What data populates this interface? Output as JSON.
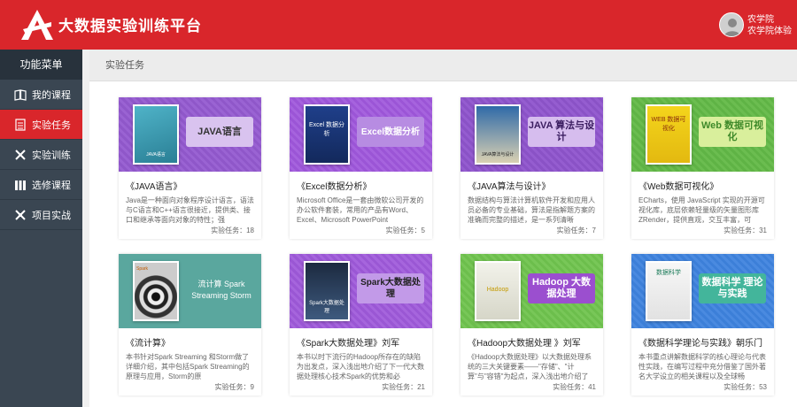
{
  "header": {
    "brand": "大数据实验训练平台",
    "user_line1": "农学院",
    "user_line2": "农学院体验"
  },
  "sidebar": {
    "title": "功能菜单",
    "items": [
      {
        "label": "我的课程",
        "icon": "book-icon"
      },
      {
        "label": "实验任务",
        "icon": "list-icon"
      },
      {
        "label": "实验训练",
        "icon": "tools-icon"
      },
      {
        "label": "选修课程",
        "icon": "library-icon"
      },
      {
        "label": "项目实战",
        "icon": "crossed-tools-icon"
      }
    ]
  },
  "breadcrumb": "实验任务",
  "colors": {
    "brand_red": "#d9262b",
    "sidebar_dark": "#3a4652"
  },
  "cards": [
    {
      "title": "《JAVA语言》",
      "desc": "Java是一种面向对象程序设计语言，语法与C语言和C++语言很接近，提供类、接口和继承等面向对象的特性；强",
      "count_label": "实验任务：18",
      "banner": "JAVA语言",
      "book_text": "JAVA语言"
    },
    {
      "title": "《Excel数据分析》",
      "desc": "Microsoft Office是一套由微软公司开发的办公软件套装，常用的产品有Word、Excel、Microsoft PowerPoint",
      "count_label": "实验任务：5",
      "banner": "Excel数据分析",
      "book_text": "Excel 数据分析"
    },
    {
      "title": "《JAVA算法与设计》",
      "desc": "数据结构与算法计算机软件开发和应用人员必备的专业基础，算法是指解题方案的准确而完整的描述，是一系列清晰",
      "count_label": "实验任务：7",
      "banner": "JAVA 算法与设计",
      "book_text": "JAVA算法与设计"
    },
    {
      "title": "《Web数据可视化》",
      "desc": "ECharts，使用 JavaScript 实现的开源可视化库，底层依赖轻量级的矢量图形库 ZRender，提供直观，交互丰富，可",
      "count_label": "实验任务：31",
      "banner": "Web 数据可视化",
      "book_text": "WEB 数据可视化"
    },
    {
      "title": "《流计算》",
      "desc": "本书针对Spark Streaming 和Storm做了详细介绍，其中包括Spark Streaming的原理与应用，Storm的原",
      "count_label": "实验任务：9",
      "banner": "流计算 Spark Streaming Storm",
      "book_text": "Spark"
    },
    {
      "title": "《Spark大数据处理》刘军",
      "desc": "本书以时下流行的Hadoop所存在的缺陷为出发点，深入浅出地介绍了下一代大数据处理核心技术Spark的优势和必",
      "count_label": "实验任务：21",
      "banner": "Spark大数据处理",
      "book_text": "Spark大数据处理"
    },
    {
      "title": "《Hadoop大数据处理 》刘军",
      "desc": "《Hadoop大数据处理》以大数据处理系统的三大关键要素——\"存储\"、\"计算\"与\"容错\"为起点，深入浅出地介绍了",
      "count_label": "实验任务：41",
      "banner": "Hadoop 大数据处理",
      "book_text": "Hadoop"
    },
    {
      "title": "《数据科学理论与实践》朝乐门",
      "desc": "本书重点讲解数据科学的核心理论与代表性实践，在编写过程中充分借鉴了国外著名大学设立的相关课程以及全球畅",
      "count_label": "实验任务：53",
      "banner": "数据科学 理论与实践",
      "book_text": "数据科学"
    }
  ]
}
